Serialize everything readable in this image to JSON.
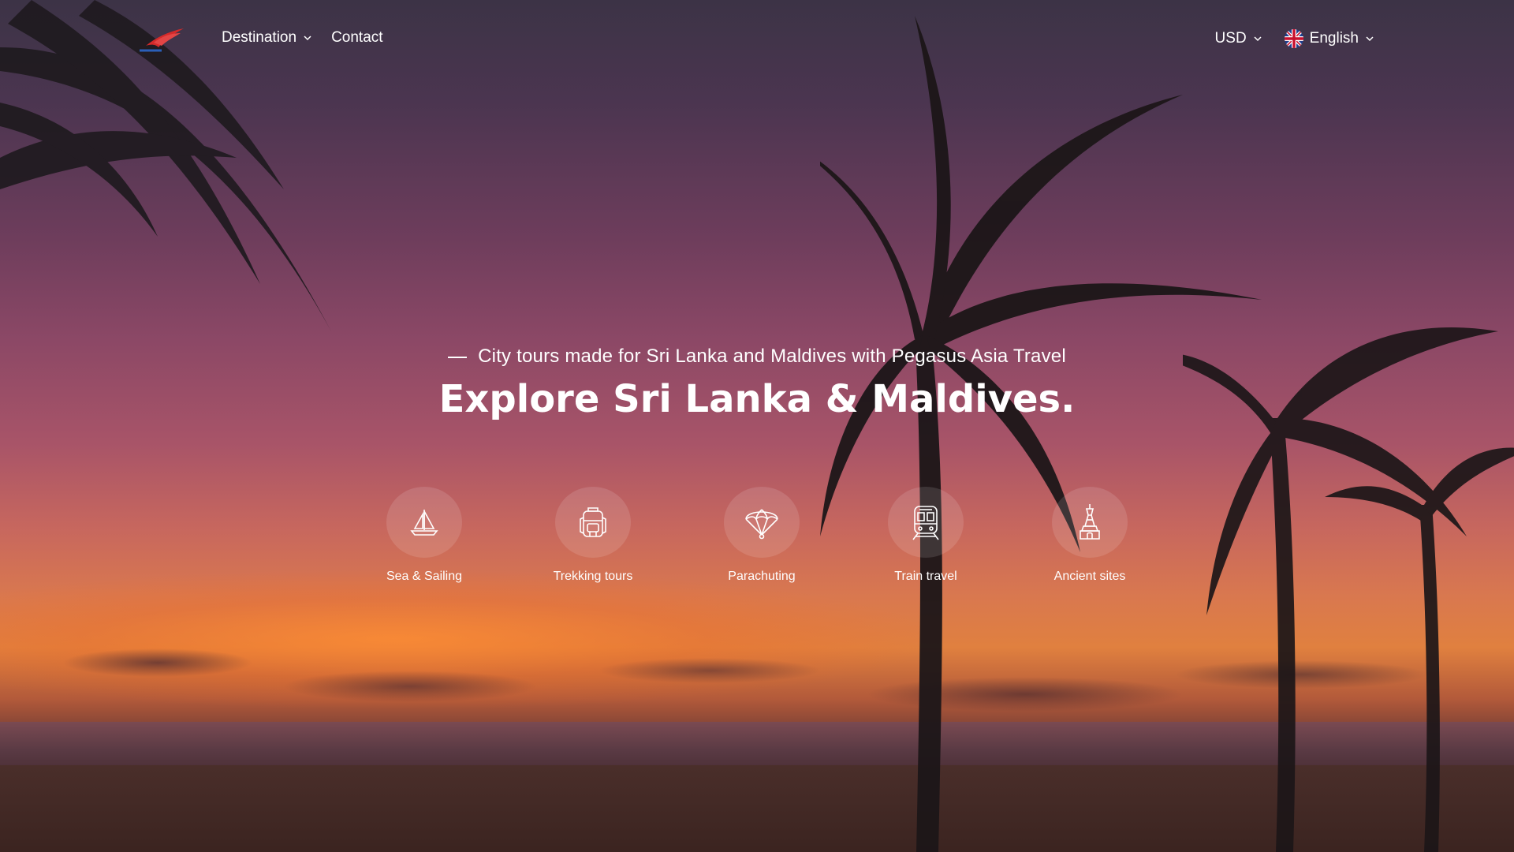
{
  "header": {
    "logo_icon": "pegasus-logo",
    "nav": [
      {
        "label": "Destination",
        "icon": "chevron-down-icon"
      },
      {
        "label": "Contact"
      }
    ],
    "currency": {
      "label": "USD",
      "icon": "chevron-down-icon"
    },
    "language": {
      "label": "English",
      "flag_icon": "uk-flag-icon",
      "icon": "chevron-down-icon"
    }
  },
  "hero": {
    "tagline": "City tours made for Sri Lanka and Maldives with Pegasus Asia Travel",
    "headline": "Explore Sri Lanka & Maldives."
  },
  "categories": [
    {
      "label": "Sea & Sailing",
      "icon": "sailboat-icon"
    },
    {
      "label": "Trekking tours",
      "icon": "backpack-icon"
    },
    {
      "label": "Parachuting",
      "icon": "parachute-icon"
    },
    {
      "label": "Train travel",
      "icon": "train-icon"
    },
    {
      "label": "Ancient sites",
      "icon": "tower-icon"
    }
  ],
  "colors": {
    "sky_top": "#3c3346",
    "sky_mid": "#8c4866",
    "horizon": "#e0803f",
    "text": "#ffffff"
  }
}
